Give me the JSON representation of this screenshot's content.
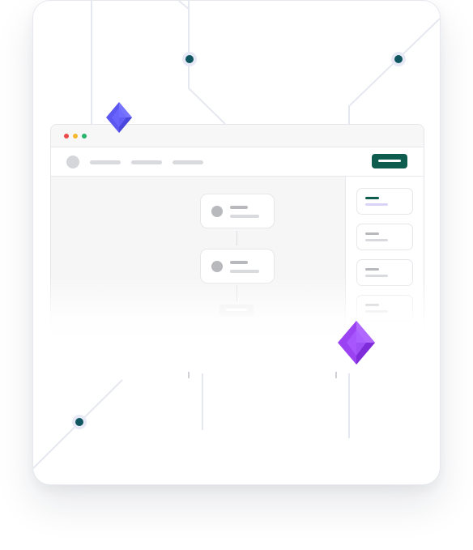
{
  "colors": {
    "accent": "#0d5c4d",
    "node": "#0f5661",
    "node_halo": "#e7eaf6",
    "gem_blue": "#5b57f0",
    "gem_purple": "#9b43f3",
    "window_dot_red": "#ef4a4a",
    "window_dot_yellow": "#f5b82e",
    "window_dot_green": "#27b36b",
    "placeholder_dark": "#b8b9bd",
    "placeholder_light": "#d9dadd",
    "selected_lavender": "#d9d3f7"
  },
  "browser_window": {
    "title_dots": [
      "red",
      "yellow",
      "green"
    ],
    "nav_links_count": 3,
    "primary_button_label": ""
  },
  "workflow": {
    "nodes_shown": 2,
    "sidebar_items_shown": 4,
    "selected_sidebar_index": 0
  },
  "icons": [
    "node-dot-icon",
    "blue-gem-icon",
    "purple-gem-icon"
  ]
}
